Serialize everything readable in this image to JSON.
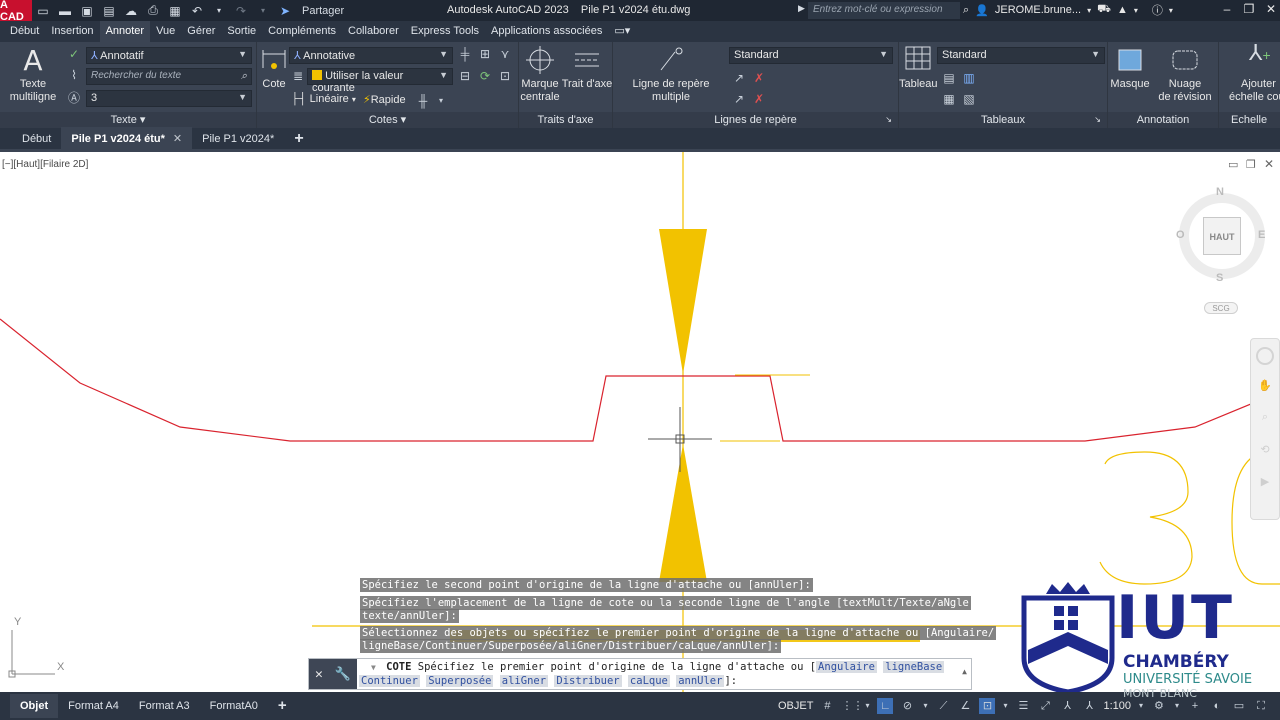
{
  "titlebar": {
    "logo": "A CAD",
    "share_label": "Partager",
    "title": "Autodesk AutoCAD 2023    Pile P1 v2024 étu.dwg",
    "search_placeholder": "Entrez mot-clé ou expression",
    "user": "JEROME.brune..."
  },
  "menu_tabs": [
    "Début",
    "Insertion",
    "Annoter",
    "Vue",
    "Gérer",
    "Sortie",
    "Compléments",
    "Collaborer",
    "Express Tools",
    "Applications associées"
  ],
  "active_menu_tab": "Annoter",
  "ribbon": {
    "texte": {
      "big_label_1": "Texte",
      "big_label_2": "multiligne",
      "style_value": "Annotatif",
      "search_placeholder": "Rechercher du texte",
      "height_value": "3",
      "panel_title": "Texte"
    },
    "cotes": {
      "big_label": "Cote",
      "style_value": "Annotative",
      "layer_value": "Utiliser la valeur courante",
      "lineaire_label": "Linéaire",
      "rapide_label": "Rapide",
      "panel_title": "Cotes"
    },
    "traits_axe": {
      "marque_1": "Marque",
      "marque_2": "centrale",
      "trait_label": "Trait d'axe",
      "panel_title": "Traits d'axe"
    },
    "lignes_repere": {
      "big_label": "Ligne de repère multiple",
      "style_value": "Standard",
      "panel_title": "Lignes de repère"
    },
    "tableaux": {
      "big_label": "Tableau",
      "style_value": "Standard",
      "panel_title": "Tableaux"
    },
    "annotation": {
      "masque_label": "Masque",
      "nuage_1": "Nuage",
      "nuage_2": "de révision",
      "panel_title": "Annotation"
    },
    "echelle": {
      "ajouter_1": "Ajouter",
      "ajouter_2": "échelle cou",
      "panel_title": "Echelle d'a"
    }
  },
  "doc_tabs": [
    {
      "label": "Début",
      "active": false
    },
    {
      "label": "Pile P1 v2024 étu*",
      "active": true
    },
    {
      "label": "Pile P1 v2024*",
      "active": false
    }
  ],
  "viewport_label": "[−][Haut][Filaire 2D]",
  "viewcube": {
    "north": "N",
    "south": "S",
    "east": "E",
    "west": "O",
    "face": "HAUT",
    "ucs": "SCG"
  },
  "command_history": [
    "Spécifiez le second point d'origine de la ligne d'attache ou [annUler]:",
    "Spécifiez l'emplacement de la ligne de cote ou la seconde ligne de l'angle [textMult/Texte/aNgle",
    "texte/annUler]:",
    "Sélectionnez des objets ou spécifiez le premier point d'origine de la ligne d'attache ou [Angulaire/",
    "ligneBase/Continuer/Superposée/aliGner/Distribuer/caLque/annUler]:"
  ],
  "command_line": {
    "command": "COTE",
    "prompt": "Spécifiez le premier point d'origine de la ligne d'attache ou [",
    "options_line1": [
      "Angulaire",
      "ligneBase"
    ],
    "options_line2": [
      "Continuer",
      "Superposée",
      "aliGner",
      "Distribuer",
      "caLque",
      "annUler"
    ],
    "suffix": "]:"
  },
  "ucs_icon": {
    "x_label": "X",
    "y_label": "Y"
  },
  "layout_tabs": [
    "Objet",
    "Format A4",
    "Format A3",
    "FormatA0"
  ],
  "active_layout_tab": "Objet",
  "status": {
    "model_label": "OBJET",
    "scale": "1:100"
  },
  "watermark": {
    "name": "IUT",
    "city": "CHAMBÉRY",
    "university": "UNIVERSITÉ SAVOIE",
    "region": "MONT BLANC"
  },
  "colors": {
    "drawing_yellow": "#f2c200",
    "profile_red": "#d9232e",
    "iut_blue": "#1f2a8c"
  }
}
